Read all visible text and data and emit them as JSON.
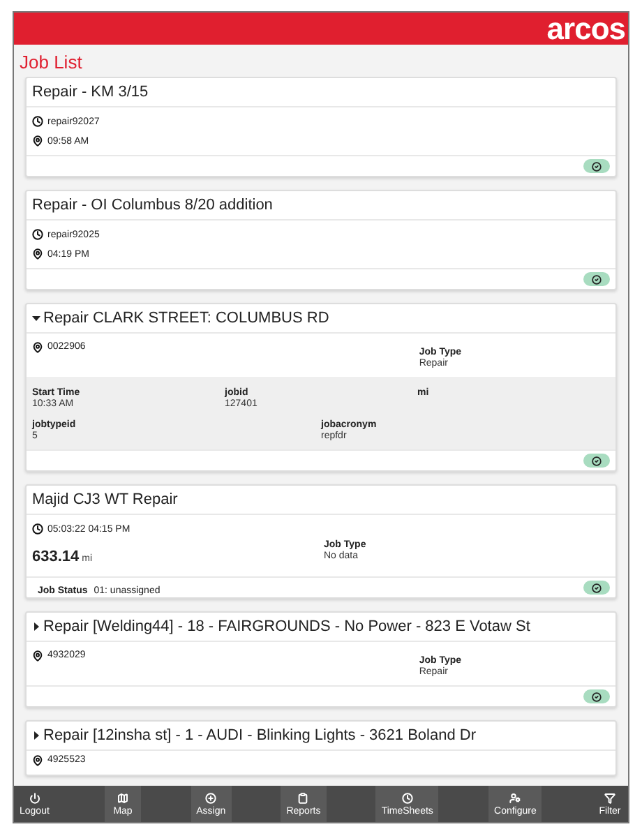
{
  "header": {
    "logo": "arcos"
  },
  "title": "Job List",
  "jobs": [
    {
      "kind": "simple",
      "title": "Repair - KM 3/15",
      "clock": "repair92027",
      "pin": "09:58 AM"
    },
    {
      "kind": "simple",
      "title": "Repair - OI Columbus 8/20 addition",
      "clock": "repair92025",
      "pin": "04:19 PM"
    },
    {
      "kind": "collapsible",
      "expanded": true,
      "title": "Repair CLARK STREET: COLUMBUS RD",
      "pin": "0022906",
      "job_type": {
        "label": "Job Type",
        "value": "Repair"
      },
      "details": [
        [
          {
            "label": "Start Time",
            "value": "10:33 AM"
          },
          {
            "label": "jobid",
            "value": "127401"
          },
          {
            "label": "mi"
          }
        ],
        [
          {
            "label": "jobtypeid",
            "value": "5"
          },
          {
            "label": "jobacronym",
            "value": "repfdr"
          }
        ]
      ]
    },
    {
      "kind": "mileage",
      "title": "Majid CJ3 WT Repair",
      "clock": "05:03:22 04:15 PM",
      "miles": "633.14",
      "miles_unit": "mi",
      "job_type": {
        "label": "Job Type",
        "value": "No data"
      },
      "status": {
        "label": "Job Status",
        "value": "01: unassigned"
      }
    },
    {
      "kind": "collapsible",
      "expanded": false,
      "title": "Repair [Welding44] - 18 - FAIRGROUNDS - No Power - 823 E Votaw St",
      "pin": "4932029",
      "job_type": {
        "label": "Job Type",
        "value": "Repair"
      }
    },
    {
      "kind": "partial",
      "expanded": false,
      "title": "Repair [12insha st] - 1 - AUDI - Blinking Lights - 3621 Boland Dr",
      "pin": "4925523"
    }
  ],
  "nav": [
    {
      "label": "Logout"
    },
    {
      "label": "Map"
    },
    {
      "label": "Assign"
    },
    {
      "label": "Reports"
    },
    {
      "label": "TimeSheets"
    },
    {
      "label": "Configure"
    },
    {
      "label": "Filter"
    }
  ]
}
